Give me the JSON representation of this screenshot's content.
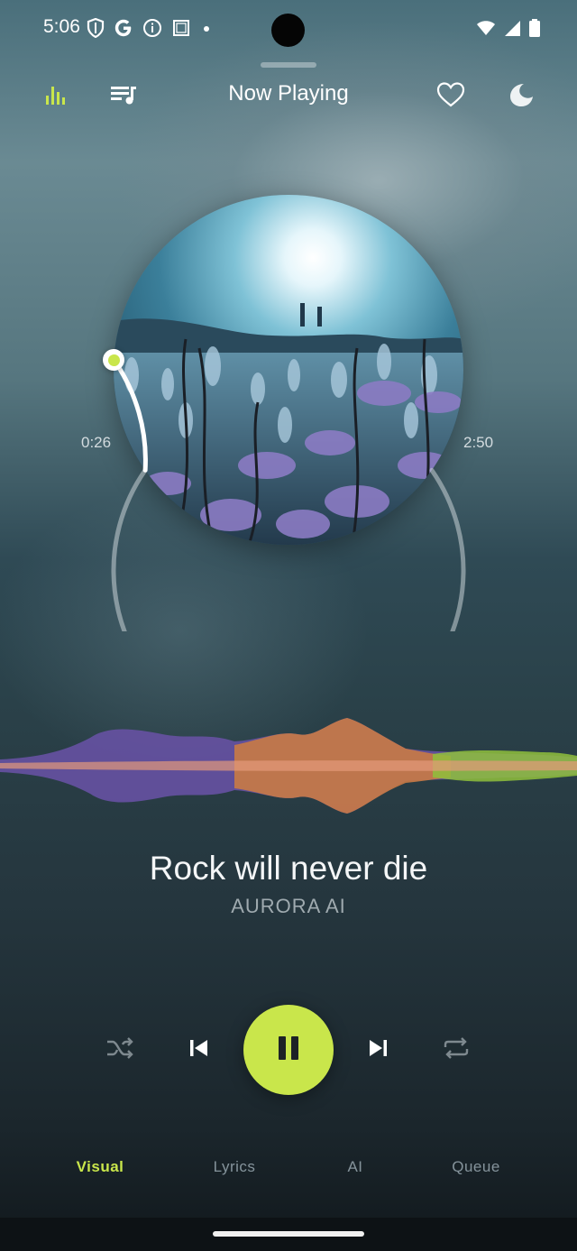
{
  "status": {
    "time": "5:06",
    "left_icons": [
      "shield-icon",
      "google-g-icon",
      "info-icon",
      "screenshot-icon",
      "dot-icon"
    ],
    "right_icons": [
      "wifi-icon",
      "signal-icon",
      "battery-icon"
    ]
  },
  "header": {
    "title": "Now Playing",
    "left_icons": [
      "equalizer-icon",
      "playlist-icon"
    ],
    "right_icons": [
      "heart-icon",
      "moon-icon"
    ],
    "accent": "#c9e64b"
  },
  "player": {
    "elapsed": "0:26",
    "duration": "2:50",
    "progress_fraction": 0.153,
    "song_title": "Rock will never die",
    "artist": "AURORA AI"
  },
  "controls": {
    "icons": [
      "shuffle-icon",
      "previous-icon",
      "pause-icon",
      "next-icon",
      "repeat-icon"
    ],
    "play_color": "#c9e64b"
  },
  "tabs": [
    {
      "label": "Visual",
      "active": true
    },
    {
      "label": "Lyrics",
      "active": false
    },
    {
      "label": "AI",
      "active": false
    },
    {
      "label": "Queue",
      "active": false
    }
  ]
}
